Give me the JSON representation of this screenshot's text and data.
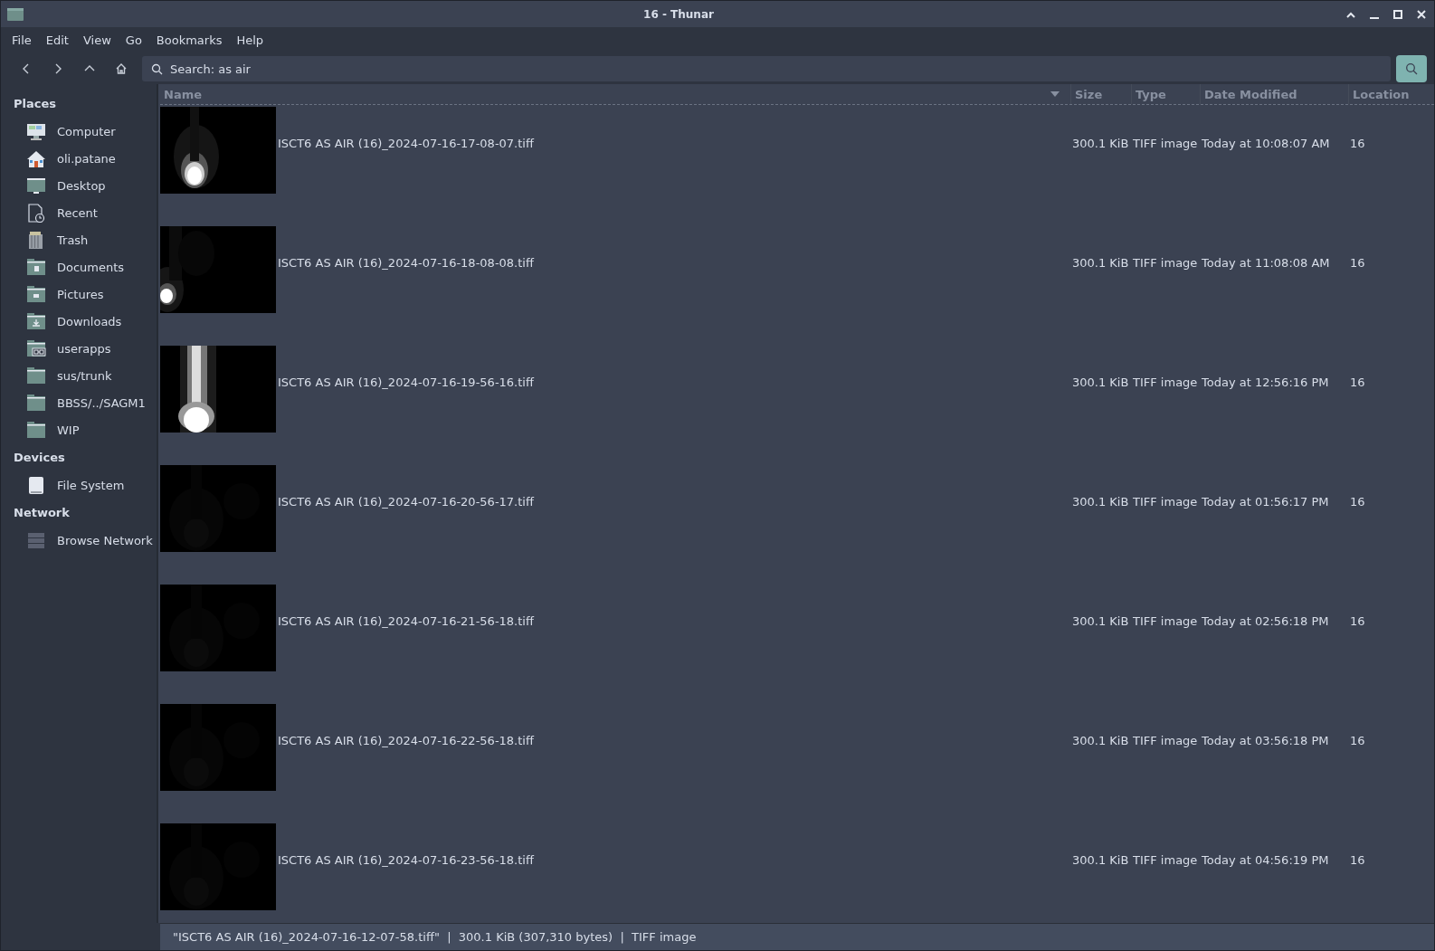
{
  "window": {
    "title": "16 - Thunar"
  },
  "menu": [
    "File",
    "Edit",
    "View",
    "Go",
    "Bookmarks",
    "Help"
  ],
  "location": {
    "value": "Search: as air"
  },
  "sidebar": {
    "sections": [
      {
        "title": "Places",
        "items": [
          {
            "label": "Computer"
          },
          {
            "label": "oli.patane"
          },
          {
            "label": "Desktop"
          },
          {
            "label": "Recent"
          },
          {
            "label": "Trash"
          },
          {
            "label": "Documents"
          },
          {
            "label": "Pictures"
          },
          {
            "label": "Downloads"
          },
          {
            "label": "userapps"
          },
          {
            "label": "sus/trunk"
          },
          {
            "label": "BBSS/../SAGM1"
          },
          {
            "label": "WIP"
          }
        ]
      },
      {
        "title": "Devices",
        "items": [
          {
            "label": "File System"
          }
        ]
      },
      {
        "title": "Network",
        "items": [
          {
            "label": "Browse Network"
          }
        ]
      }
    ]
  },
  "table": {
    "columns": [
      {
        "label": "Name",
        "sorted": true
      },
      {
        "label": "Size",
        "sorted": false
      },
      {
        "label": "Type",
        "sorted": false
      },
      {
        "label": "Date Modified",
        "sorted": false
      },
      {
        "label": "Location",
        "sorted": false
      }
    ],
    "rows": [
      {
        "name": "ISCT6 AS AIR (16)_2024-07-16-17-08-07.tiff",
        "size": "300.1 KiB",
        "type": "TIFF image",
        "date_modified": "Today at 10:08:07 AM",
        "location": "16"
      },
      {
        "name": "ISCT6 AS AIR (16)_2024-07-16-18-08-08.tiff",
        "size": "300.1 KiB",
        "type": "TIFF image",
        "date_modified": "Today at 11:08:08 AM",
        "location": "16"
      },
      {
        "name": "ISCT6 AS AIR (16)_2024-07-16-19-56-16.tiff",
        "size": "300.1 KiB",
        "type": "TIFF image",
        "date_modified": "Today at 12:56:16 PM",
        "location": "16"
      },
      {
        "name": "ISCT6 AS AIR (16)_2024-07-16-20-56-17.tiff",
        "size": "300.1 KiB",
        "type": "TIFF image",
        "date_modified": "Today at 01:56:17 PM",
        "location": "16"
      },
      {
        "name": "ISCT6 AS AIR (16)_2024-07-16-21-56-18.tiff",
        "size": "300.1 KiB",
        "type": "TIFF image",
        "date_modified": "Today at 02:56:18 PM",
        "location": "16"
      },
      {
        "name": "ISCT6 AS AIR (16)_2024-07-16-22-56-18.tiff",
        "size": "300.1 KiB",
        "type": "TIFF image",
        "date_modified": "Today at 03:56:18 PM",
        "location": "16"
      },
      {
        "name": "ISCT6 AS AIR (16)_2024-07-16-23-56-18.tiff",
        "size": "300.1 KiB",
        "type": "TIFF image",
        "date_modified": "Today at 04:56:19 PM",
        "location": "16"
      }
    ]
  },
  "status_bar": "\"ISCT6 AS AIR (16)_2024-07-16-12-07-58.tiff\"  |  300.1 KiB (307,310 bytes)  |  TIFF image"
}
